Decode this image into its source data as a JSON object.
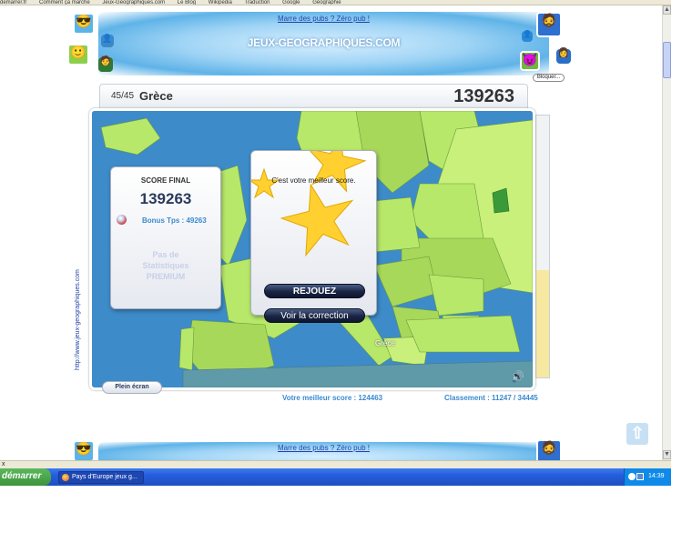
{
  "bookmarks_bar": [
    "demarrer.fr",
    "Comment ça marche",
    "Jeux-Géographiques.com",
    "Le Blog",
    "Wikipedia",
    "Traduction",
    "Google",
    "Géographie"
  ],
  "banner": {
    "pubs_link": "Marre des pubs ? Zéro pub !",
    "site_title": "JEUX-GEOGRAPHIQUES.COM",
    "bloquer": "Bloquer..."
  },
  "game": {
    "question_count": "45/45",
    "country": "Grèce",
    "score": "139263",
    "vertical_url": "http://www.jeux-geographiques.com",
    "score_panel": {
      "label": "SCORE FINAL",
      "value": "139263",
      "bonus": "Bonus Tps : 49263",
      "premium": "Pas de Statistiques PREMIUM"
    },
    "result_panel": {
      "message": "C'est votre meilleur score.",
      "replay_button": "REJOUEZ",
      "correction_button": "Voir la correction"
    },
    "map_label": "Grèce",
    "fullscreen_button": "Plein écran",
    "best_score": "Votre meilleur score : 124463",
    "classement": "Classement : 11247 / 34445"
  },
  "bottom_banner": {
    "pubs_link": "Marre des pubs ? Zéro pub !"
  },
  "statusbar": {
    "text": "x"
  },
  "taskbar": {
    "start_label": "démarrer",
    "task_title": "Pays d'Europe jeux g...",
    "clock": "14:39"
  },
  "colors": {
    "sea": "#3d8bc9",
    "land": "#b8e86a",
    "taskbar": "#245edb",
    "link": "#2244aa",
    "accent": "#3a8ad0"
  }
}
